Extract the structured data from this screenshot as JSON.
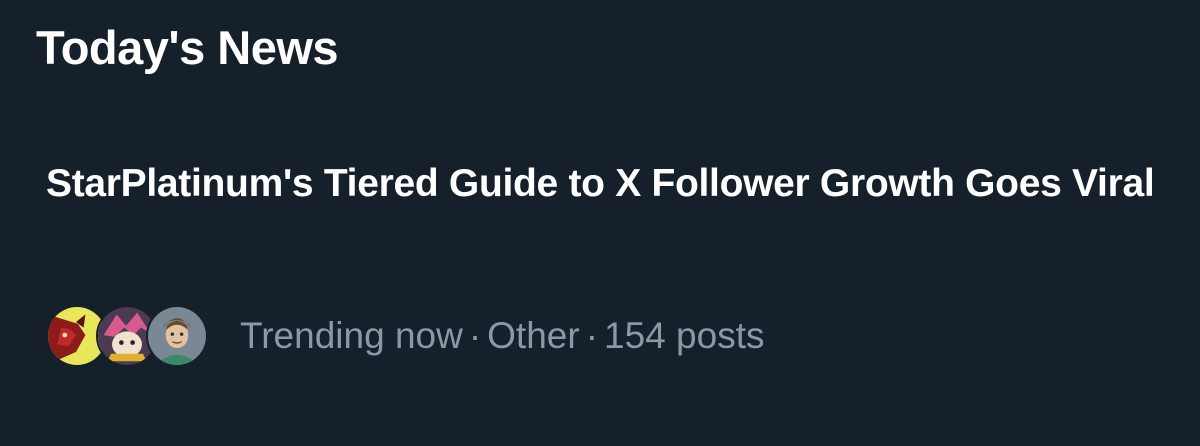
{
  "section": {
    "title": "Today's News"
  },
  "news": {
    "headline": "StarPlatinum's Tiered Guide to X Follower Growth Goes Viral",
    "meta": {
      "status": "Trending now",
      "separator": "·",
      "category": "Other",
      "post_count": "154 posts"
    },
    "avatars": [
      {
        "icon": "red-bull-on-yellow-avatar-icon"
      },
      {
        "icon": "cartoon-character-avatar-icon"
      },
      {
        "icon": "cartoon-man-avatar-icon"
      }
    ]
  },
  "colors": {
    "background": "#16202a",
    "headline": "#ffffff",
    "secondary_text": "#8b98a5"
  }
}
